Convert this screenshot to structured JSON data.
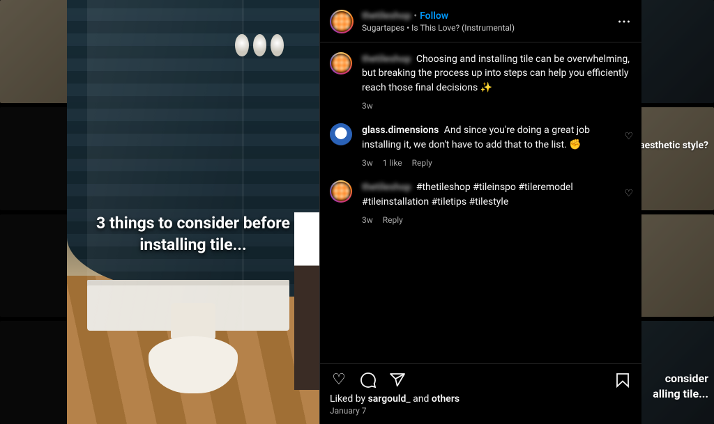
{
  "media": {
    "overlay_text": "3 things to consider before installing tile..."
  },
  "header": {
    "username": "thetileshop",
    "follow_label": "Follow",
    "audio": "Sugartapes • Is This Love? (Instrumental)"
  },
  "comments": [
    {
      "user": "thetileshop",
      "user_blurred": true,
      "avatar_style": "ring-blur",
      "text": "Choosing and installing tile can be overwhelming, but breaking the process up into steps can help you efficiently reach those final decisions ✨",
      "age": "3w",
      "likes": "",
      "reply": "",
      "show_like": false
    },
    {
      "user": "glass.dimensions",
      "user_blurred": false,
      "avatar_style": "plain",
      "text": "And since you're doing a great job installing it, we don't have to add that to the list. ✊",
      "age": "3w",
      "likes": "1 like",
      "reply": "Reply",
      "show_like": true
    },
    {
      "user": "thetileshop",
      "user_blurred": true,
      "avatar_style": "ring-blur",
      "text": "#thetileshop #tileinspo #tileremodel #tileinstallation #tiletips #tilestyle",
      "age": "3w",
      "likes": "",
      "reply": "Reply",
      "show_like": true
    }
  ],
  "actions": {
    "liked_by_prefix": "Liked by ",
    "liked_by_user": "sargould_",
    "liked_by_suffix": " and ",
    "liked_by_others": "others",
    "date": "January 7"
  },
  "bg_overlays": {
    "top_right": "an aesthetic style?",
    "bottom_right_1": "consider",
    "bottom_right_2": "alling tile..."
  },
  "labels": {
    "sep_dot": "•"
  }
}
